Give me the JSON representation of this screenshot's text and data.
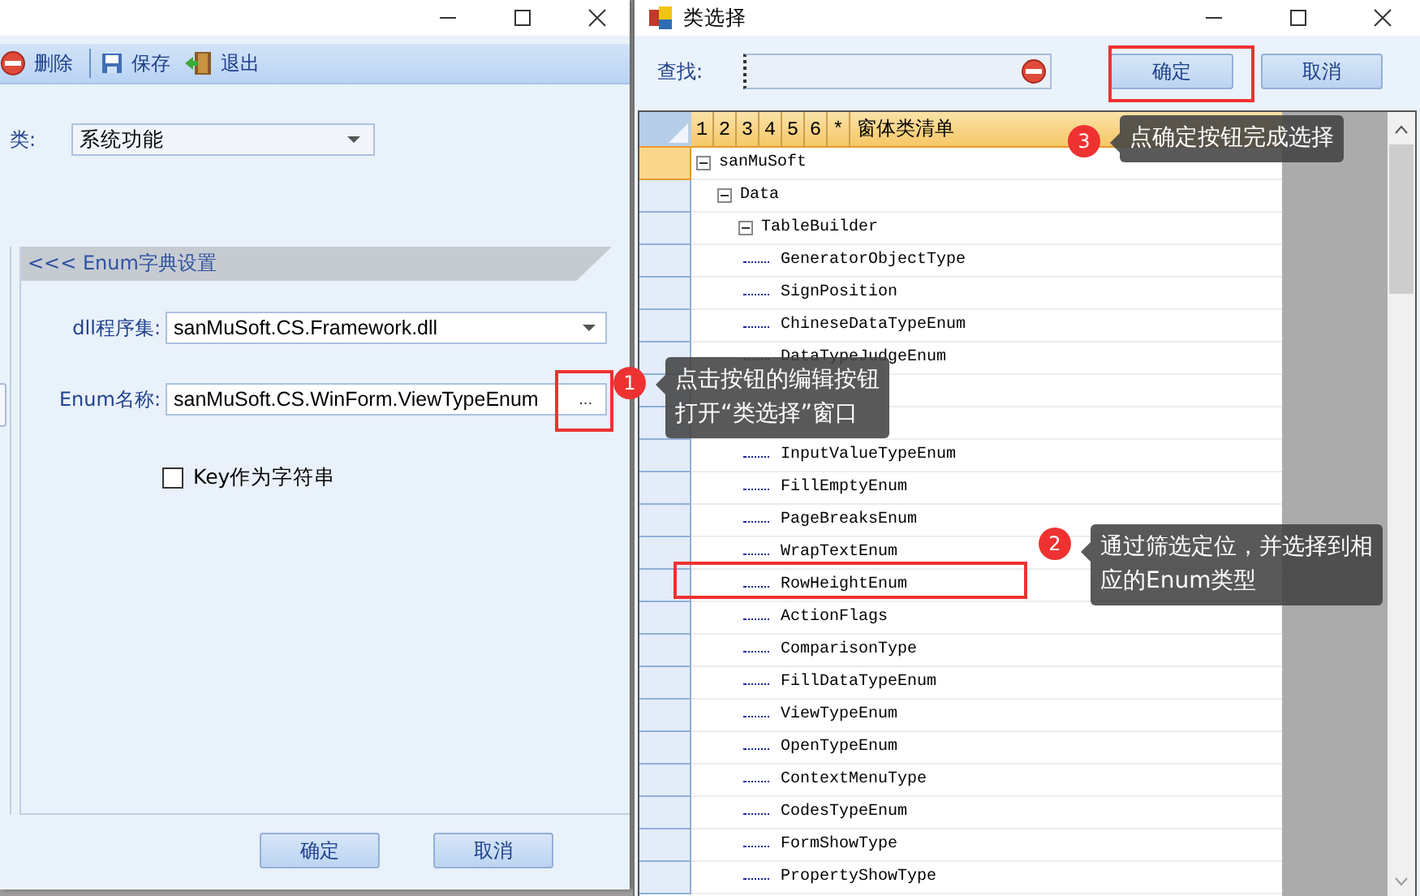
{
  "main_window": {
    "toolbar": [
      {
        "kind": "delete",
        "label": "删除"
      },
      {
        "kind": "save",
        "label": "保存"
      },
      {
        "kind": "exit",
        "label": "退出"
      }
    ],
    "category": {
      "label": "类:",
      "value": "系统功能"
    },
    "group": {
      "title": "<<< Enum字典设置",
      "assembly": {
        "label": "dll程序集:",
        "value": "sanMuSoft.CS.Framework.dll"
      },
      "enum_name": {
        "label": "Enum名称:",
        "value": "sanMuSoft.CS.WinForm.ViewTypeEnum",
        "button": "..."
      },
      "key_as_string": {
        "label": "Key作为字符串",
        "checked": false
      }
    },
    "buttons": [
      "确定",
      "取消"
    ]
  },
  "dialog": {
    "title": "类选择",
    "search": {
      "label": "查找:"
    },
    "buttons": [
      "确定",
      "取消"
    ],
    "grid": {
      "columns": [
        "1",
        "2",
        "3",
        "4",
        "5",
        "6",
        "*",
        "窗体类清单"
      ],
      "tree": [
        {
          "kind": "node",
          "label": "sanMuSoft",
          "selected": true,
          "expanded": true,
          "children": [
            {
              "kind": "node",
              "label": "Data",
              "selected": false,
              "expanded": true,
              "children": [
                {
                  "kind": "node",
                  "label": "TableBuilder",
                  "selected": false,
                  "expanded": true,
                  "children": [
                    {
                      "kind": "node",
                      "label": "GeneratorObjectType",
                      "selected": false
                    },
                    {
                      "kind": "node",
                      "label": "SignPosition",
                      "selected": false
                    },
                    {
                      "kind": "node",
                      "label": "ChineseDataTypeEnum",
                      "selected": false
                    },
                    {
                      "kind": "node",
                      "label": "DataTypeJudgeEnum",
                      "selected": false
                    },
                    {
                      "kind": "covered"
                    }
                  ]
                },
                {
                  "kind": "covered",
                  "children": [
                    {
                      "kind": "node",
                      "label": "InputValueTypeEnum",
                      "selected": false
                    },
                    {
                      "kind": "node",
                      "label": "FillEmptyEnum",
                      "selected": false
                    },
                    {
                      "kind": "node",
                      "label": "PageBreaksEnum",
                      "selected": false
                    },
                    {
                      "kind": "node",
                      "label": "WrapTextEnum",
                      "selected": false
                    },
                    {
                      "kind": "node",
                      "label": "RowHeightEnum",
                      "selected": false
                    },
                    {
                      "kind": "node",
                      "label": "ActionFlags",
                      "selected": false
                    },
                    {
                      "kind": "node",
                      "label": "ComparisonType",
                      "selected": false
                    },
                    {
                      "kind": "node",
                      "label": "FillDataTypeEnum",
                      "selected": false
                    },
                    {
                      "kind": "node",
                      "label": "ViewTypeEnum",
                      "selected": false
                    },
                    {
                      "kind": "node",
                      "label": "OpenTypeEnum",
                      "selected": false
                    },
                    {
                      "kind": "node",
                      "label": "ContextMenuType",
                      "selected": false
                    },
                    {
                      "kind": "node",
                      "label": "CodesTypeEnum",
                      "selected": false
                    },
                    {
                      "kind": "node",
                      "label": "FormShowType",
                      "selected": false
                    },
                    {
                      "kind": "node",
                      "label": "PropertyShowType",
                      "selected": false
                    }
                  ]
                }
              ]
            }
          ]
        }
      ]
    }
  },
  "callouts": [
    {
      "number": "3",
      "lines": [
        "点确定按钮完成选择"
      ]
    },
    {
      "number": "1",
      "lines": [
        "点击按钮的编辑按钮",
        "打开“类选择”窗口"
      ]
    },
    {
      "number": "2",
      "lines": [
        "通过筛选定位，并选择到相",
        "应的Enum类型"
      ]
    }
  ]
}
